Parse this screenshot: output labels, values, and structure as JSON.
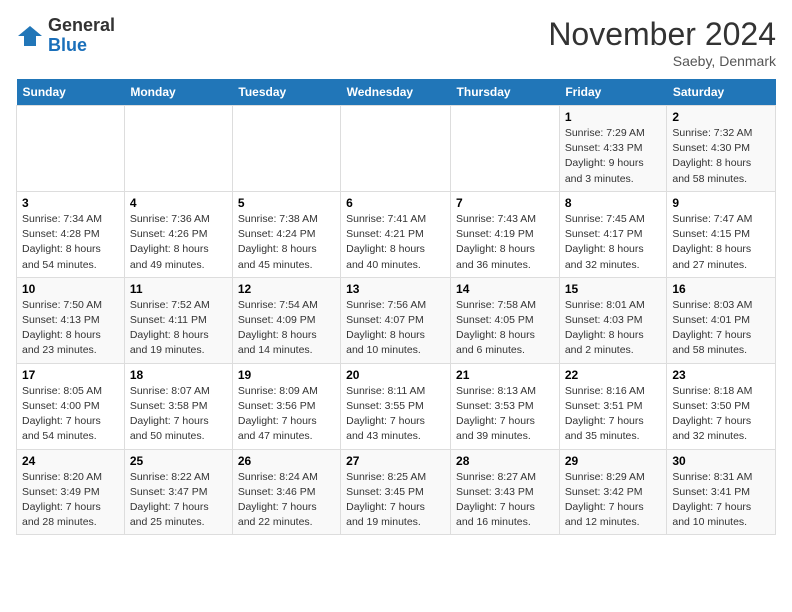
{
  "header": {
    "logo_line1": "General",
    "logo_line2": "Blue",
    "month_title": "November 2024",
    "location": "Saeby, Denmark"
  },
  "weekdays": [
    "Sunday",
    "Monday",
    "Tuesday",
    "Wednesday",
    "Thursday",
    "Friday",
    "Saturday"
  ],
  "weeks": [
    [
      {
        "day": "",
        "info": ""
      },
      {
        "day": "",
        "info": ""
      },
      {
        "day": "",
        "info": ""
      },
      {
        "day": "",
        "info": ""
      },
      {
        "day": "",
        "info": ""
      },
      {
        "day": "1",
        "info": "Sunrise: 7:29 AM\nSunset: 4:33 PM\nDaylight: 9 hours\nand 3 minutes."
      },
      {
        "day": "2",
        "info": "Sunrise: 7:32 AM\nSunset: 4:30 PM\nDaylight: 8 hours\nand 58 minutes."
      }
    ],
    [
      {
        "day": "3",
        "info": "Sunrise: 7:34 AM\nSunset: 4:28 PM\nDaylight: 8 hours\nand 54 minutes."
      },
      {
        "day": "4",
        "info": "Sunrise: 7:36 AM\nSunset: 4:26 PM\nDaylight: 8 hours\nand 49 minutes."
      },
      {
        "day": "5",
        "info": "Sunrise: 7:38 AM\nSunset: 4:24 PM\nDaylight: 8 hours\nand 45 minutes."
      },
      {
        "day": "6",
        "info": "Sunrise: 7:41 AM\nSunset: 4:21 PM\nDaylight: 8 hours\nand 40 minutes."
      },
      {
        "day": "7",
        "info": "Sunrise: 7:43 AM\nSunset: 4:19 PM\nDaylight: 8 hours\nand 36 minutes."
      },
      {
        "day": "8",
        "info": "Sunrise: 7:45 AM\nSunset: 4:17 PM\nDaylight: 8 hours\nand 32 minutes."
      },
      {
        "day": "9",
        "info": "Sunrise: 7:47 AM\nSunset: 4:15 PM\nDaylight: 8 hours\nand 27 minutes."
      }
    ],
    [
      {
        "day": "10",
        "info": "Sunrise: 7:50 AM\nSunset: 4:13 PM\nDaylight: 8 hours\nand 23 minutes."
      },
      {
        "day": "11",
        "info": "Sunrise: 7:52 AM\nSunset: 4:11 PM\nDaylight: 8 hours\nand 19 minutes."
      },
      {
        "day": "12",
        "info": "Sunrise: 7:54 AM\nSunset: 4:09 PM\nDaylight: 8 hours\nand 14 minutes."
      },
      {
        "day": "13",
        "info": "Sunrise: 7:56 AM\nSunset: 4:07 PM\nDaylight: 8 hours\nand 10 minutes."
      },
      {
        "day": "14",
        "info": "Sunrise: 7:58 AM\nSunset: 4:05 PM\nDaylight: 8 hours\nand 6 minutes."
      },
      {
        "day": "15",
        "info": "Sunrise: 8:01 AM\nSunset: 4:03 PM\nDaylight: 8 hours\nand 2 minutes."
      },
      {
        "day": "16",
        "info": "Sunrise: 8:03 AM\nSunset: 4:01 PM\nDaylight: 7 hours\nand 58 minutes."
      }
    ],
    [
      {
        "day": "17",
        "info": "Sunrise: 8:05 AM\nSunset: 4:00 PM\nDaylight: 7 hours\nand 54 minutes."
      },
      {
        "day": "18",
        "info": "Sunrise: 8:07 AM\nSunset: 3:58 PM\nDaylight: 7 hours\nand 50 minutes."
      },
      {
        "day": "19",
        "info": "Sunrise: 8:09 AM\nSunset: 3:56 PM\nDaylight: 7 hours\nand 47 minutes."
      },
      {
        "day": "20",
        "info": "Sunrise: 8:11 AM\nSunset: 3:55 PM\nDaylight: 7 hours\nand 43 minutes."
      },
      {
        "day": "21",
        "info": "Sunrise: 8:13 AM\nSunset: 3:53 PM\nDaylight: 7 hours\nand 39 minutes."
      },
      {
        "day": "22",
        "info": "Sunrise: 8:16 AM\nSunset: 3:51 PM\nDaylight: 7 hours\nand 35 minutes."
      },
      {
        "day": "23",
        "info": "Sunrise: 8:18 AM\nSunset: 3:50 PM\nDaylight: 7 hours\nand 32 minutes."
      }
    ],
    [
      {
        "day": "24",
        "info": "Sunrise: 8:20 AM\nSunset: 3:49 PM\nDaylight: 7 hours\nand 28 minutes."
      },
      {
        "day": "25",
        "info": "Sunrise: 8:22 AM\nSunset: 3:47 PM\nDaylight: 7 hours\nand 25 minutes."
      },
      {
        "day": "26",
        "info": "Sunrise: 8:24 AM\nSunset: 3:46 PM\nDaylight: 7 hours\nand 22 minutes."
      },
      {
        "day": "27",
        "info": "Sunrise: 8:25 AM\nSunset: 3:45 PM\nDaylight: 7 hours\nand 19 minutes."
      },
      {
        "day": "28",
        "info": "Sunrise: 8:27 AM\nSunset: 3:43 PM\nDaylight: 7 hours\nand 16 minutes."
      },
      {
        "day": "29",
        "info": "Sunrise: 8:29 AM\nSunset: 3:42 PM\nDaylight: 7 hours\nand 12 minutes."
      },
      {
        "day": "30",
        "info": "Sunrise: 8:31 AM\nSunset: 3:41 PM\nDaylight: 7 hours\nand 10 minutes."
      }
    ]
  ]
}
